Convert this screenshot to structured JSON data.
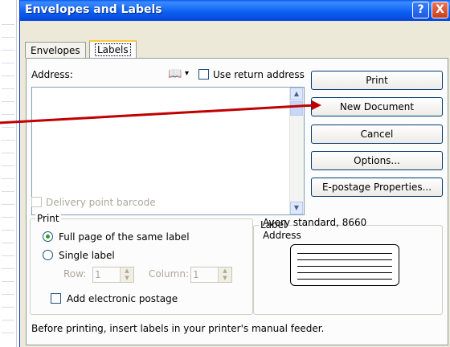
{
  "window": {
    "title": "Envelopes and Labels",
    "help_glyph": "?",
    "close_glyph": "X"
  },
  "tabs": [
    {
      "label": "Envelopes",
      "selected": false
    },
    {
      "label": "Labels",
      "selected": true
    }
  ],
  "address": {
    "label": "Address:",
    "value": "",
    "book_icon": "address-book-icon",
    "book_dropdown": "▾",
    "use_return_label": "Use return address",
    "use_return_checked": false
  },
  "buttons": {
    "print": "Print",
    "new_document": "New Document",
    "cancel": "Cancel",
    "options": "Options...",
    "epostage": "E-postage Properties..."
  },
  "delivery_barcode": {
    "label": "Delivery point barcode",
    "checked": false,
    "enabled": false
  },
  "print_group": {
    "title": "Print",
    "full_page": "Full page of the same label",
    "single_label": "Single label",
    "selected": "full_page",
    "row_label": "Row:",
    "row_value": "1",
    "column_label": "Column:",
    "column_value": "1",
    "add_postage": "Add electronic postage",
    "add_postage_checked": false
  },
  "label_group": {
    "title": "Label",
    "line1": "Avery standard, 8660",
    "line2": "Address"
  },
  "footer": "Before printing, insert labels in your printer's manual feeder.",
  "colors": {
    "titlebar": "#0a5ef0",
    "dialog_bg": "#ece9d8",
    "annotation_arrow": "#c00000"
  }
}
